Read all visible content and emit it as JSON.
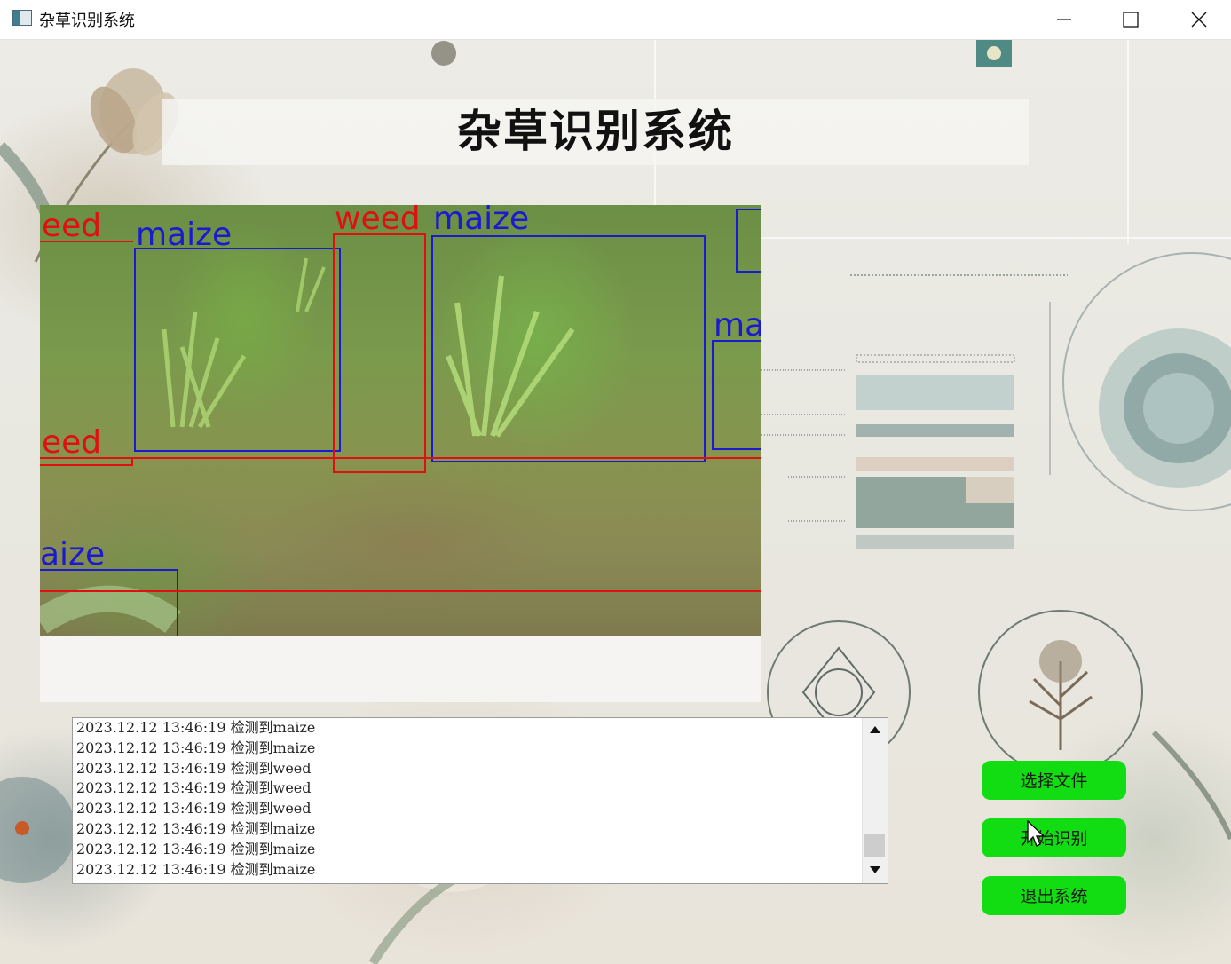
{
  "window": {
    "title": "杂草识别系统",
    "controls": {
      "minimize": "minimize",
      "maximize": "maximize",
      "close": "close"
    }
  },
  "header": {
    "title": "杂草识别系统"
  },
  "detection_image": {
    "labels": {
      "weed_top_left": "eed",
      "maize_1": "maize",
      "weed_mid": "weed",
      "maize_2": "maize",
      "maize_right": "ma",
      "weed_lower_left": "eed",
      "maize_bottom_left": "aize"
    }
  },
  "log": {
    "lines": [
      "2023.12.12 13:46:19 检测到maize",
      "2023.12.12 13:46:19 检测到maize",
      "2023.12.12 13:46:19 检测到weed",
      "2023.12.12 13:46:19 检测到weed",
      "2023.12.12 13:46:19 检测到weed",
      "2023.12.12 13:46:19 检测到maize",
      "2023.12.12 13:46:19 检测到maize",
      "2023.12.12 13:46:19 检测到maize"
    ]
  },
  "buttons": {
    "select_file": "选择文件",
    "start_recognition": "开始识别",
    "exit_system": "退出系统"
  },
  "colors": {
    "button_green": "#12dd12",
    "weed_box": "#e01010",
    "maize_box": "#1a1ad0"
  }
}
